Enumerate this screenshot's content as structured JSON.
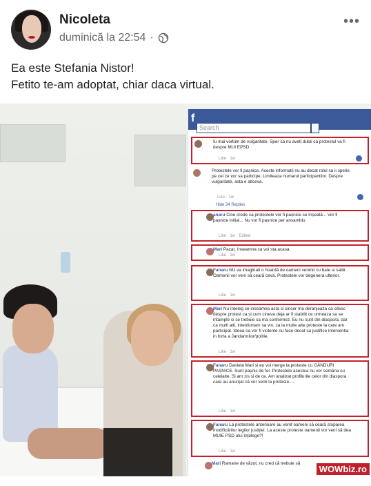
{
  "post": {
    "author": "Nicoleta",
    "timestamp": "duminică la 22:54",
    "separator": "·",
    "privacy_icon": "globe-icon",
    "more_label": "•••",
    "text_line1": "Ea este Stefania Nistor!",
    "text_line2": "Fetito te-am adoptat, chiar daca virtual."
  },
  "screenshot": {
    "search_placeholder": "Search",
    "comments": [
      {
        "text": "Iu mai vorbim de vulgaritate. Sper ca nu aveti dubii ca protestul va fi despre MUI EPSD",
        "like": "Like · 1w"
      },
      {
        "text": "Protestele vor fi pașnice. Aceste informatii nu au decat rolul sa ii sperie pe cei ce vor sa participe. Limiteaza numarul participantilor. Despre vulgaritate, asta e altceva.",
        "like": "Like · 1w"
      },
      {
        "text": "Hide 34 Replies"
      },
      {
        "name": "anaru",
        "text": "Cine crede ca protestele vor fi pașnice se înșeală... Vor fi pașnice initial... Nu vor fi pașnice per ansamblu",
        "like": "Like · 1w · Edited"
      },
      {
        "name": "Mari",
        "text": "Pacat. Inseamna ca voi sta acasa.",
        "like": "Like · 1w"
      },
      {
        "name": "Fanaru",
        "text": "NU va imaginati o hoardă de oameni venind cu bate si sabii. Oamenii vor veni să ceară ceva. Protestele vor degenera ulterior.",
        "like": "Like · 1w"
      },
      {
        "name": "Mari",
        "text": "Nu înțeleg ce inseamna asta si sincer ma deranjeaza ca citesc despre protest ca si cum cineva deja ar fi stabilit ce urmeaza sa se intample si ce trebuie sa ma conformez. Eu nu sunt din diaspora, dar ca multi alti, intentionam sa vin, ca la multe alte proteste la care am participat. Ideea ca vor fi violente nu face decat sa justifice interventia in forta a Jandarmilor/politie.",
        "like": "Like · 1w"
      },
      {
        "name": "Fanaru",
        "text": "Daniela Mari si eu voi merge la proteste cu GÂNDURI PAȘNICE. Sunt pașnic de fel. Protestele acestea nu vor semăna cu celelalte. Si am zis si de ce. Am analizat profilurile celor din diaspora care au anunțat că vor venii la proteste....",
        "like": "Like · 1w"
      },
      {
        "name": "Fanaru",
        "text": "La protestele anterioare au venit oameni să ceară stoparea modificărilor legilor justiției. La aceste proteste oamenii vor veni să dea MUIE PSD ului înțelege?!",
        "like": "Like · 1w"
      },
      {
        "name": "Mari",
        "text": "Ramane de văzut, nu cred că trebuie să"
      }
    ]
  },
  "watermark": "WOWbiz.ro"
}
